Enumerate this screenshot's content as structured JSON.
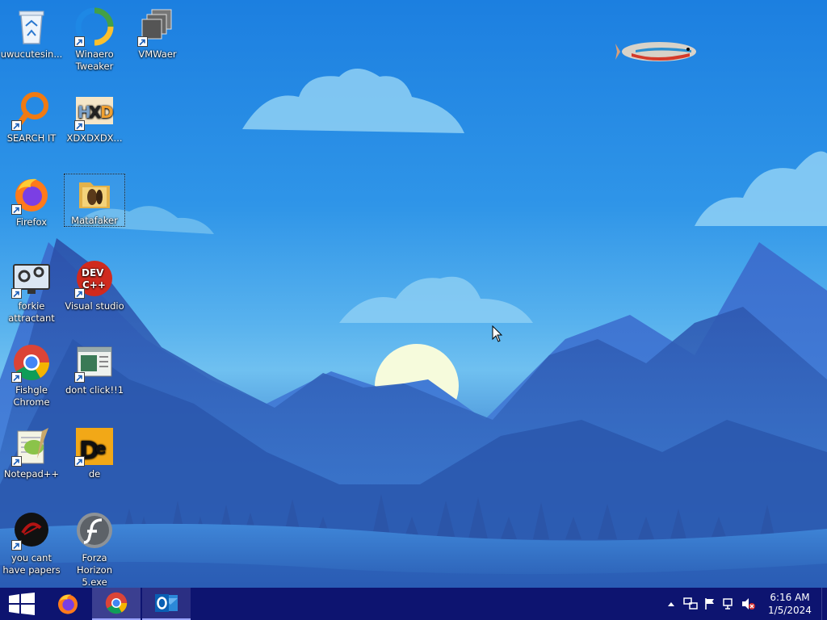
{
  "desktop": {
    "icons": [
      {
        "label": "uwucutesin...",
        "icon": "recycle-bin-icon"
      },
      {
        "label": "Winaero Tweaker",
        "icon": "winaero-tweaker-icon"
      },
      {
        "label": "VMWaer",
        "icon": "vmware-icon"
      },
      {
        "label": "SEARCH IT",
        "icon": "magnifier-icon"
      },
      {
        "label": "XDXDXDX...",
        "icon": "hxd-icon"
      },
      {
        "label": "Firefox",
        "icon": "firefox-icon"
      },
      {
        "label": "Matafaker",
        "icon": "folder-icon"
      },
      {
        "label": "forkie attractant",
        "icon": "settings-monitor-icon"
      },
      {
        "label": "Visual studio",
        "icon": "dev-cpp-icon"
      },
      {
        "label": "Fishgle Chrome",
        "icon": "chrome-icon"
      },
      {
        "label": "dont click!!1",
        "icon": "window-app-icon"
      },
      {
        "label": "Notepad++",
        "icon": "notepad-plus-plus-icon"
      },
      {
        "label": "de",
        "icon": "de-icon"
      },
      {
        "label": "you cant have papers",
        "icon": "dark-circle-icon"
      },
      {
        "label": "Forza Horizon 5.exe",
        "icon": "flash-player-icon"
      }
    ]
  },
  "taskbar": {
    "start": "windows-logo-icon",
    "pinned": [
      {
        "name": "Firefox",
        "icon": "firefox-icon"
      },
      {
        "name": "Google Chrome",
        "icon": "chrome-icon"
      },
      {
        "name": "Outlook",
        "icon": "outlook-icon"
      }
    ],
    "tray": {
      "time": "6:16 AM",
      "date": "1/5/2024"
    }
  },
  "colors": {
    "taskbar": "#0d1470",
    "sky": "#2f95e8",
    "mountains": "#2e5fb5"
  }
}
